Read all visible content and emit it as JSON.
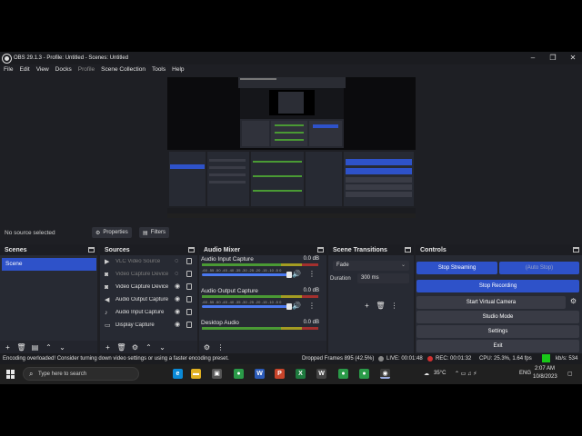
{
  "window": {
    "title": "OBS 29.1.3 - Profile: Untitled - Scenes: Untitled"
  },
  "menu": [
    "File",
    "Edit",
    "View",
    "Docks",
    "Profile",
    "Scene Collection",
    "Tools",
    "Help"
  ],
  "source_toolbar": {
    "no_source": "No source selected",
    "properties": "Properties",
    "filters": "Filters"
  },
  "scenes": {
    "title": "Scenes",
    "items": [
      "Scene"
    ]
  },
  "sources": {
    "title": "Sources",
    "items": [
      {
        "name": "VLC Video Source",
        "icon": "play-icon",
        "visible": false
      },
      {
        "name": "Video Capture Device",
        "icon": "camera-icon",
        "visible": false
      },
      {
        "name": "Video Capture Device",
        "icon": "camera-icon",
        "visible": true
      },
      {
        "name": "Audio Output Capture",
        "icon": "speaker-icon",
        "visible": true
      },
      {
        "name": "Audio Input Capture",
        "icon": "microphone-icon",
        "visible": true
      },
      {
        "name": "Display Capture",
        "icon": "monitor-icon",
        "visible": true
      }
    ]
  },
  "mixer": {
    "title": "Audio Mixer",
    "ticks": "-60 -55 -50 -45 -40 -35 -30 -25 -20 -15 -10 -5 0",
    "channels": [
      {
        "name": "Audio Input Capture",
        "db": "0.0 dB"
      },
      {
        "name": "Audio Output Capture",
        "db": "0.0 dB"
      },
      {
        "name": "Desktop Audio",
        "db": "0.0 dB"
      }
    ]
  },
  "transitions": {
    "title": "Scene Transitions",
    "type": "Fade",
    "duration_label": "Duration",
    "duration": "300 ms"
  },
  "controls": {
    "title": "Controls",
    "stop_streaming": "Stop Streaming",
    "auto_stop": "(Auto Stop)",
    "stop_recording": "Stop Recording",
    "virtual_camera": "Start Virtual Camera",
    "studio_mode": "Studio Mode",
    "settings": "Settings",
    "exit": "Exit"
  },
  "status": {
    "message": "Encoding overloaded! Consider turning down video settings or using a faster encoding preset.",
    "dropped": "Dropped Frames 895 (42.5%)",
    "live": "LIVE: 00:01:48",
    "rec": "REC: 00:01:32",
    "cpu": "CPU: 25.3%, 1.64 fps",
    "kbs": "kb/s: 534"
  },
  "taskbar": {
    "search_placeholder": "Type here to search",
    "temperature": "35°C",
    "lang": "ENG",
    "time": "2:07 AM",
    "date": "10/8/2023"
  },
  "colors": {
    "accent": "#2e52c9",
    "dock": "#272a33",
    "background": "#1e1f24"
  }
}
